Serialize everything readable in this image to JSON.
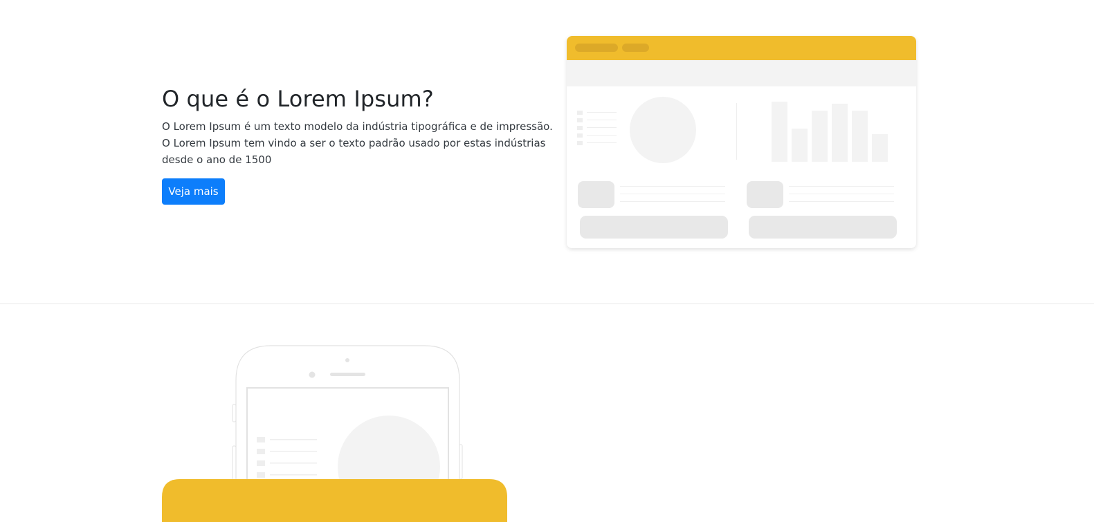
{
  "hero": {
    "title": "O que é o Lorem Ipsum?",
    "description_lines": [
      "O Lorem Ipsum é um texto modelo da indústria tipográfica e de impressão.",
      "O Lorem Ipsum tem vindo a ser o texto padrão usado por estas indústrias",
      "desde o ano de 1500"
    ],
    "button_label": "Veja mais"
  },
  "colors": {
    "accent_yellow": "#f0bc2c",
    "button_blue": "#0d7efb",
    "placeholder_gray": "#f3f3f3"
  },
  "illustrations": {
    "browser_mockup": "dashboard-browser-illustration",
    "phone_mockup": "smartphone-illustration"
  }
}
